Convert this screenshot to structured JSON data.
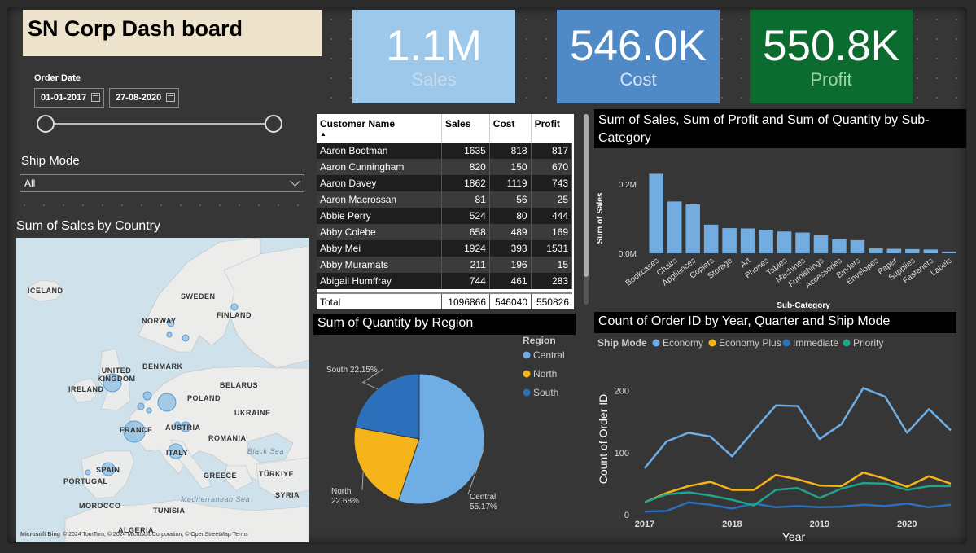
{
  "title": "SN Corp Dash board",
  "kpis": {
    "sales": {
      "value": "1.1M",
      "label": "Sales"
    },
    "cost": {
      "value": "546.0K",
      "label": "Cost"
    },
    "profit": {
      "value": "550.8K",
      "label": "Profit"
    }
  },
  "filters": {
    "order_date_label": "Order Date",
    "start_date": "01-01-2017",
    "end_date": "27-08-2020",
    "range_fraction": [
      0,
      1
    ],
    "ship_mode_label": "Ship Mode",
    "ship_mode_value": "All"
  },
  "map": {
    "title": "Sum of Sales by Country",
    "labels": {
      "iceland": "ICELAND",
      "sweden": "SWEDEN",
      "finland": "FINLAND",
      "norway": "NORWAY",
      "united_kingdom": "UNITED KINGDOM",
      "denmark": "DENMARK",
      "belarus": "BELARUS",
      "ireland": "IRELAND",
      "poland": "POLAND",
      "ukraine": "UKRAINE",
      "france": "FRANCE",
      "austria": "AUSTRIA",
      "romania": "ROMANIA",
      "italy": "ITALY",
      "black_sea": "Black Sea",
      "spain": "SPAIN",
      "greece": "GREECE",
      "turkiye": "TÜRKIYE",
      "portugal": "PORTUGAL",
      "mediterranean": "Mediterranean Sea",
      "syria": "SYRIA",
      "morocco": "MOROCCO",
      "tunisia": "TUNISIA",
      "algeria": "ALGERIA"
    },
    "footer_bing": "Microsoft Bing",
    "footer_text": "© 2024 TomTom, © 2024 Microsoft Corporation, © OpenStreetMap  Terms"
  },
  "table": {
    "headers": [
      "Customer Name",
      "Sales",
      "Cost",
      "Profit"
    ],
    "rows": [
      [
        "Aaron Bootman",
        "1635",
        "818",
        "817"
      ],
      [
        "Aaron Cunningham",
        "820",
        "150",
        "670"
      ],
      [
        "Aaron Davey",
        "1862",
        "1119",
        "743"
      ],
      [
        "Aaron Macrossan",
        "81",
        "56",
        "25"
      ],
      [
        "Abbie Perry",
        "524",
        "80",
        "444"
      ],
      [
        "Abby Colebe",
        "658",
        "489",
        "169"
      ],
      [
        "Abby Mei",
        "1924",
        "393",
        "1531"
      ],
      [
        "Abby Muramats",
        "211",
        "196",
        "15"
      ],
      [
        "Abigail Humffray",
        "744",
        "461",
        "283"
      ]
    ],
    "total": [
      "Total",
      "1096866",
      "546040",
      "550826"
    ]
  },
  "bar_title": "Sum of Sales, Sum of Profit and Sum of Quantity by Sub-Category",
  "pie_title": "Sum of Quantity by Region",
  "line_title": "Count of Order ID by Year, Quarter and Ship Mode",
  "line_legend_label": "Ship Mode",
  "pie_legend_label": "Region",
  "colors": {
    "bar": "#73ade0",
    "central": "#6eaee4",
    "north": "#f5b51a",
    "south": "#2c6fba",
    "economy": "#6eaee4",
    "economy_plus": "#f5b51a",
    "immediate": "#2c6fba",
    "priority": "#1fa588"
  },
  "chart_data": [
    {
      "type": "bar",
      "title": "Sum of Sales, Sum of Profit and Sum of Quantity by Sub-Category",
      "xlabel": "Sub-Category",
      "ylabel": "Sum of Sales",
      "categories": [
        "Bookcases",
        "Chairs",
        "Appliances",
        "Copiers",
        "Storage",
        "Art",
        "Phones",
        "Tables",
        "Machines",
        "Furnishings",
        "Accessories",
        "Binders",
        "Envelopes",
        "Paper",
        "Supplies",
        "Fasteners",
        "Labels"
      ],
      "values": [
        230000,
        150000,
        142000,
        83000,
        73000,
        72000,
        68000,
        63000,
        60000,
        52000,
        40000,
        38000,
        14000,
        13000,
        12000,
        11000,
        5000
      ],
      "yticks": [
        "0.0M",
        "0.2M"
      ],
      "ylim": [
        0,
        250000
      ]
    },
    {
      "type": "pie",
      "title": "Sum of Quantity by Region",
      "legend_title": "Region",
      "labels": [
        "Central",
        "North",
        "South"
      ],
      "values": [
        55.17,
        22.68,
        22.15
      ],
      "value_labels": [
        "55.17%",
        "22.68%",
        "22.15%"
      ]
    },
    {
      "type": "line",
      "title": "Count of Order ID by Year, Quarter and Ship Mode",
      "xlabel": "Year",
      "ylabel": "Count of Order ID",
      "legend_title": "Ship Mode",
      "x": [
        "2017 Q1",
        "2017 Q2",
        "2017 Q3",
        "2017 Q4",
        "2018 Q1",
        "2018 Q2",
        "2018 Q3",
        "2018 Q4",
        "2019 Q1",
        "2019 Q2",
        "2019 Q3",
        "2019 Q4",
        "2020 Q1",
        "2020 Q2",
        "2020 Q3"
      ],
      "xticks": [
        "2017",
        "2018",
        "2019",
        "2020"
      ],
      "yticks": [
        "0",
        "100",
        "200"
      ],
      "ylim": [
        0,
        240
      ],
      "series": [
        {
          "name": "Economy",
          "values": [
            75,
            118,
            132,
            126,
            94,
            136,
            176,
            175,
            122,
            146,
            204,
            190,
            132,
            170,
            136
          ]
        },
        {
          "name": "Economy Plus",
          "values": [
            20,
            35,
            46,
            53,
            40,
            40,
            64,
            57,
            47,
            46,
            68,
            58,
            45,
            62,
            50
          ]
        },
        {
          "name": "Immediate",
          "values": [
            5,
            6,
            20,
            16,
            10,
            18,
            12,
            14,
            12,
            13,
            16,
            14,
            18,
            12,
            16
          ]
        },
        {
          "name": "Priority",
          "values": [
            20,
            33,
            36,
            31,
            24,
            15,
            40,
            43,
            27,
            42,
            51,
            50,
            40,
            46,
            46
          ]
        }
      ]
    }
  ]
}
